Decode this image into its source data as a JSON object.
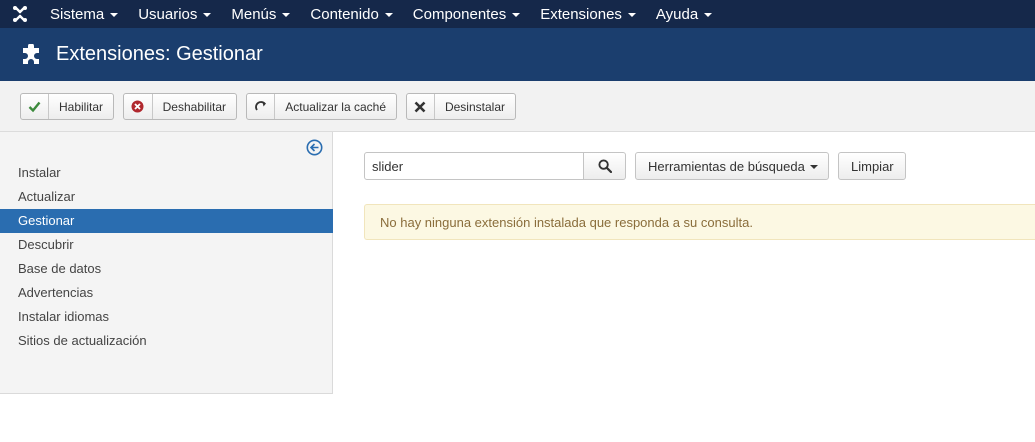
{
  "topnav": {
    "menu": [
      {
        "label": "Sistema"
      },
      {
        "label": "Usuarios"
      },
      {
        "label": "Menús"
      },
      {
        "label": "Contenido"
      },
      {
        "label": "Componentes"
      },
      {
        "label": "Extensiones"
      },
      {
        "label": "Ayuda"
      }
    ]
  },
  "header": {
    "title": "Extensiones: Gestionar",
    "icon": "puzzle-icon"
  },
  "toolbar": {
    "enable_label": "Habilitar",
    "disable_label": "Deshabilitar",
    "refresh_cache_label": "Actualizar la caché",
    "uninstall_label": "Desinstalar"
  },
  "sidebar": {
    "items": [
      {
        "label": "Instalar",
        "active": false
      },
      {
        "label": "Actualizar",
        "active": false
      },
      {
        "label": "Gestionar",
        "active": true
      },
      {
        "label": "Descubrir",
        "active": false
      },
      {
        "label": "Base de datos",
        "active": false
      },
      {
        "label": "Advertencias",
        "active": false
      },
      {
        "label": "Instalar idiomas",
        "active": false
      },
      {
        "label": "Sitios de actualización",
        "active": false
      }
    ]
  },
  "main": {
    "search_value": "slider",
    "search_tools_label": "Herramientas de búsqueda",
    "clear_label": "Limpiar",
    "alert_message": "No hay ninguna extensión instalada que responda a su consulta."
  },
  "colors": {
    "topnav_bg": "#15284a",
    "header_bg": "#1b3e6e",
    "active_item": "#2a6db0",
    "alert_bg": "#fcf8e3",
    "alert_text": "#8a6d3b",
    "enable_icon": "#3c8a3c",
    "disable_icon": "#b0282e"
  }
}
